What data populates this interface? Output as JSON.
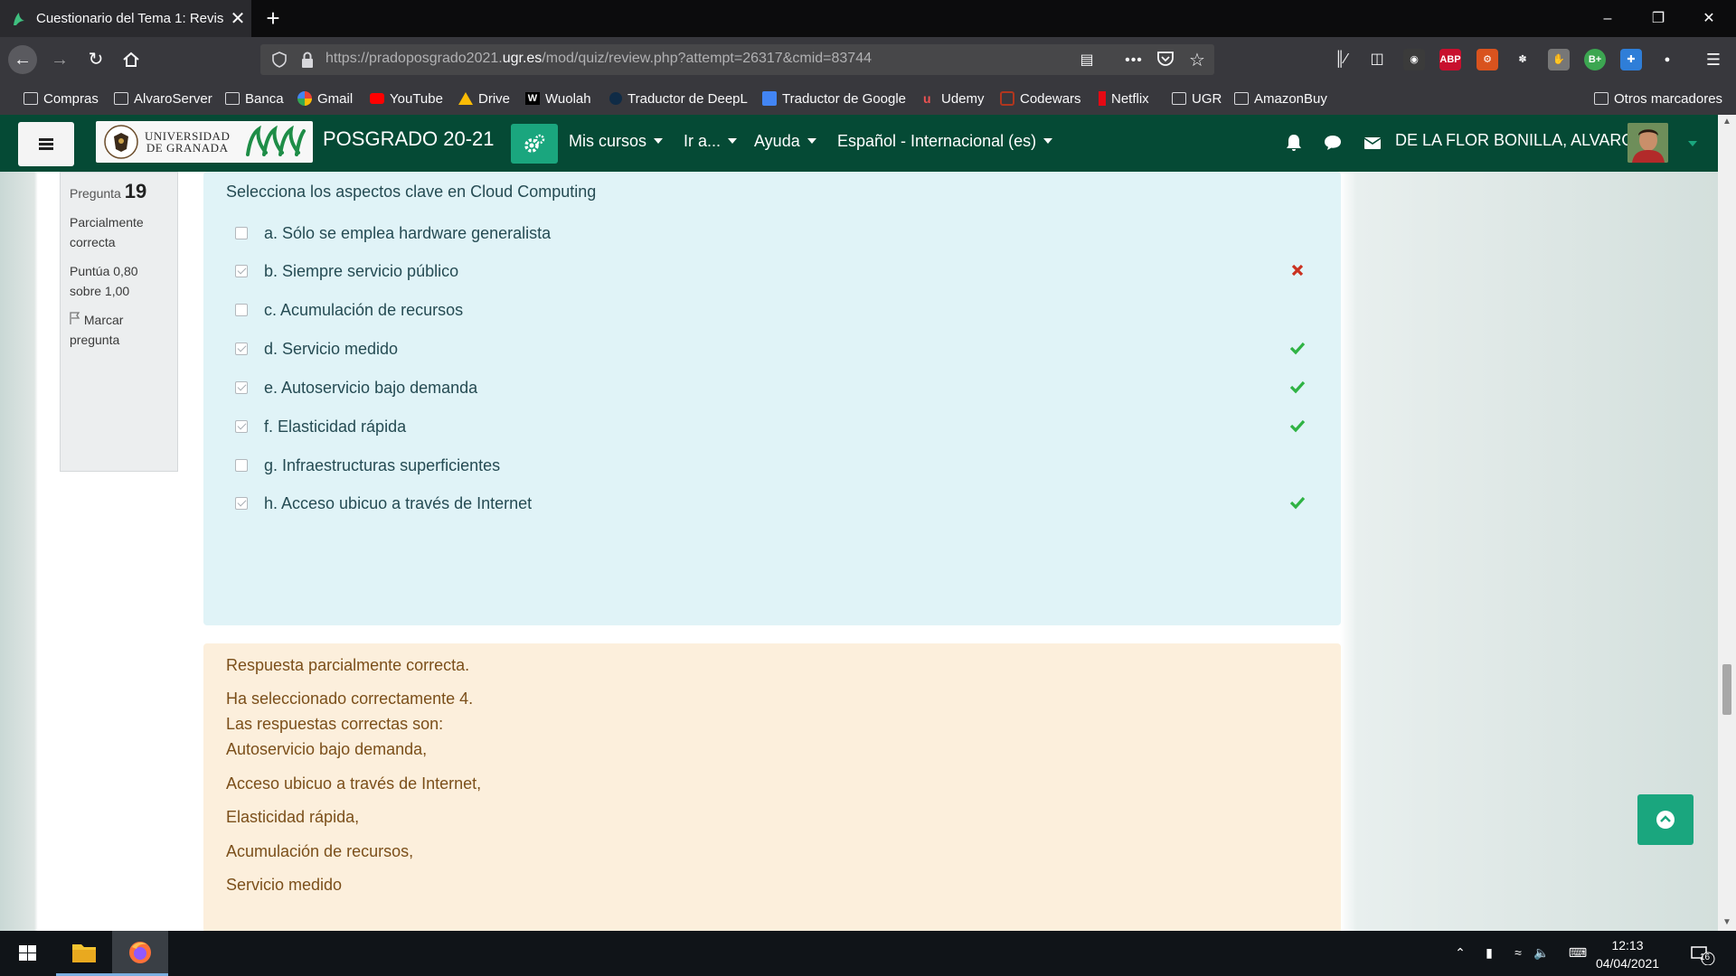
{
  "browser": {
    "tab_title": "Cuestionario del Tema 1: Revisi",
    "url_prefix": "https://pradoposgrado2021.",
    "url_domain": "ugr.es",
    "url_suffix": "/mod/quiz/review.php?attempt=26317&cmid=83744",
    "bookmarks": [
      "Compras",
      "AlvaroServer",
      "Banca",
      "Gmail",
      "YouTube",
      "Drive",
      "Wuolah",
      "Traductor de DeepL",
      "Traductor de Google",
      "Udemy",
      "Codewars",
      "Netflix",
      "UGR",
      "AmazonBuy"
    ],
    "other_bookmarks": "Otros marcadores",
    "extensions": [
      "ABP",
      "B+"
    ]
  },
  "site": {
    "logo_line1": "UNIVERSIDAD",
    "logo_line2": "DE GRANADA",
    "title": "POSGRADO 20-21",
    "menu": [
      "Mis cursos",
      "Ir a...",
      "Ayuda",
      "Español - Internacional (es)"
    ],
    "user_name": "DE LA FLOR BONILLA, ALVARO"
  },
  "question_info": {
    "label": "Pregunta",
    "number": "19",
    "state": "Parcialmente correcta",
    "grade": "Puntúa 0,80 sobre 1,00",
    "flag": "Marcar pregunta"
  },
  "question": {
    "text": "Selecciona los aspectos clave en Cloud Computing",
    "answers": [
      {
        "label": "a. Sólo se emplea hardware generalista",
        "checked": false,
        "mark": ""
      },
      {
        "label": "b. Siempre servicio público",
        "checked": true,
        "mark": "incorrect"
      },
      {
        "label": "c. Acumulación de recursos",
        "checked": false,
        "mark": ""
      },
      {
        "label": "d. Servicio medido",
        "checked": true,
        "mark": "correct"
      },
      {
        "label": "e. Autoservicio bajo demanda",
        "checked": true,
        "mark": "correct"
      },
      {
        "label": "f. Elasticidad rápida",
        "checked": true,
        "mark": "correct"
      },
      {
        "label": "g. Infraestructuras superficientes",
        "checked": false,
        "mark": ""
      },
      {
        "label": "h. Acceso ubicuo a través de Internet",
        "checked": true,
        "mark": "correct"
      }
    ]
  },
  "feedback": {
    "status": "Respuesta parcialmente correcta.",
    "selected": "Ha seleccionado correctamente 4.",
    "correct_header": "Las respuestas correctas son:",
    "correct_answers": [
      "Autoservicio bajo demanda,",
      "Acceso ubicuo a través de Internet,",
      "Elasticidad rápida,",
      "Acumulación de recursos,",
      "Servicio medido"
    ]
  },
  "taskbar": {
    "time": "12:13",
    "date": "04/04/2021",
    "notifications": "16"
  },
  "colors": {
    "moodle_nav": "#054a35",
    "accent": "#1aa67e",
    "question_bg": "#e0f3f7",
    "feedback_bg": "#fcefdc",
    "correct": "#2fb344",
    "incorrect": "#ca3120"
  }
}
